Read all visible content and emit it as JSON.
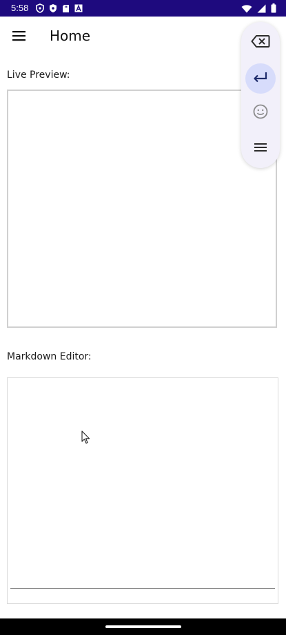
{
  "status_bar": {
    "time": "5:58",
    "left_icons": [
      "shield-icon",
      "shield-filled-icon",
      "sd-card-icon",
      "a-badge-icon"
    ],
    "right_icons": [
      "wifi-icon",
      "signal-icon",
      "battery-icon"
    ]
  },
  "app_bar": {
    "title": "Home",
    "menu_icon": "menu-icon"
  },
  "preview": {
    "label": "Live Preview:"
  },
  "editor": {
    "label": "Markdown Editor:",
    "value": ""
  },
  "floating_toolbar": {
    "buttons": [
      "backspace-icon",
      "enter-icon",
      "emoji-icon",
      "menu-icon"
    ],
    "selected": "enter-icon",
    "selected_color": "#d7dcfb"
  },
  "colors": {
    "status_bar": "#1e0a7e",
    "text": "#111111"
  }
}
